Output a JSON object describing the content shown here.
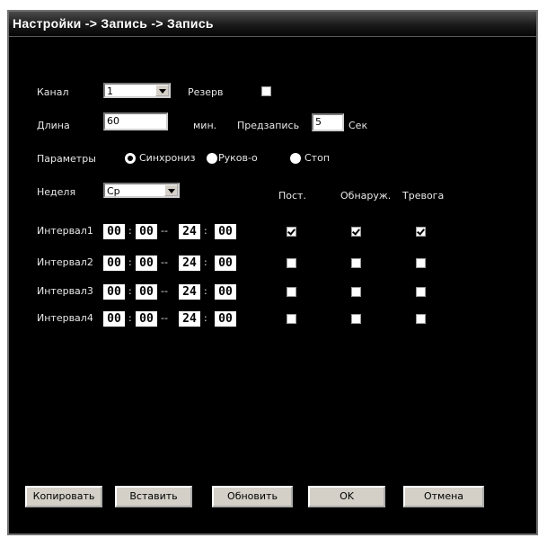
{
  "window": {
    "title": "Настройки -> Запись -> Запись"
  },
  "form": {
    "channel_label": "Канал",
    "channel_value": "1",
    "reserve_label": "Резерв",
    "reserve_checked": false,
    "length_label": "Длина",
    "length_value": "60",
    "length_unit": "мин.",
    "prerecord_label": "Предзапись",
    "prerecord_value": "5",
    "prerecord_unit": "Сек",
    "params_label": "Параметры",
    "params_options": [
      "Синхрониз",
      "Руков-о",
      "Стоп"
    ],
    "params_selected": "Синхрониз",
    "week_label": "Неделя",
    "week_value": "Ср"
  },
  "columns": {
    "constant": "Пост.",
    "detect": "Обнаруж.",
    "alarm": "Тревога"
  },
  "intervals": [
    {
      "label": "Интервал1",
      "start_h": "00",
      "start_m": "00",
      "end_h": "24",
      "end_m": "00",
      "constant": true,
      "detect": true,
      "alarm": true
    },
    {
      "label": "Интервал2",
      "start_h": "00",
      "start_m": "00",
      "end_h": "24",
      "end_m": "00",
      "constant": false,
      "detect": false,
      "alarm": false
    },
    {
      "label": "Интервал3",
      "start_h": "00",
      "start_m": "00",
      "end_h": "24",
      "end_m": "00",
      "constant": false,
      "detect": false,
      "alarm": false
    },
    {
      "label": "Интервал4",
      "start_h": "00",
      "start_m": "00",
      "end_h": "24",
      "end_m": "00",
      "constant": false,
      "detect": false,
      "alarm": false
    }
  ],
  "buttons": {
    "copy": "Копировать",
    "paste": "Вставить",
    "refresh": "Обновить",
    "ok": "OK",
    "cancel": "Отмена"
  }
}
